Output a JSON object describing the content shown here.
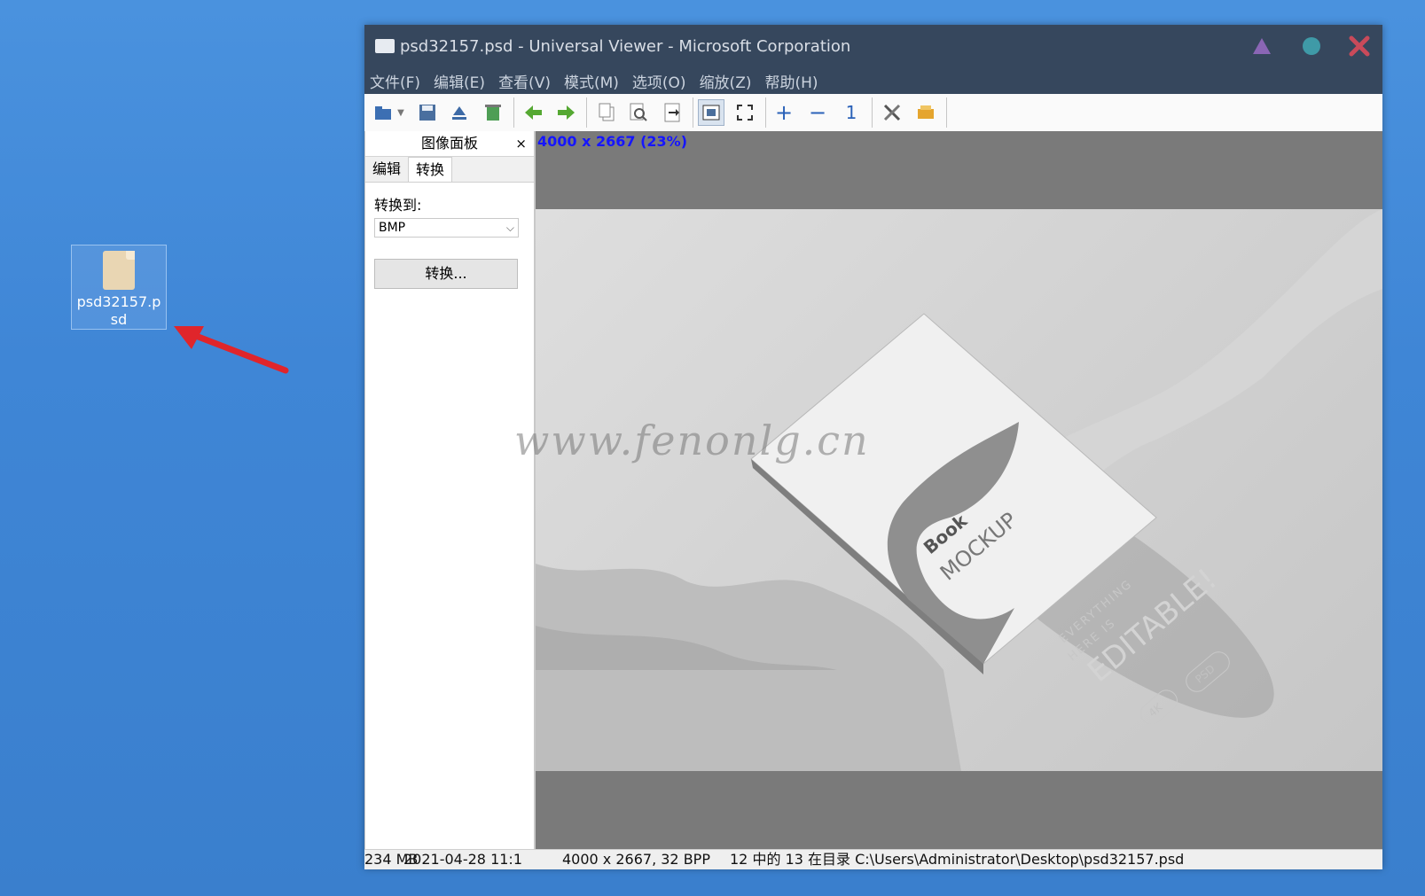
{
  "desktop": {
    "file_label": "psd32157.psd"
  },
  "window": {
    "title": "psd32157.psd - Universal Viewer - Microsoft Corporation",
    "menu": [
      "文件(F)",
      "编辑(E)",
      "查看(V)",
      "模式(M)",
      "选项(O)",
      "缩放(Z)",
      "帮助(H)"
    ],
    "toolbar_icons": [
      "open-icon",
      "dropdown-icon",
      "save-icon",
      "export-icon",
      "recycle-icon",
      "prev-icon",
      "next-icon",
      "copy-icon",
      "preview-icon",
      "print-icon",
      "fit-window-icon",
      "fullscreen-icon",
      "zoom-in-icon",
      "zoom-out-icon",
      "actual-size-icon",
      "settings-icon",
      "plugin-icon"
    ],
    "zoom_in_glyph": "+",
    "zoom_out_glyph": "−",
    "actual_size_glyph": "1",
    "colors": {
      "titlebar": "#36475d",
      "min_btn": "#8a66b5",
      "max_btn": "#3f9aa7",
      "close_btn": "#c94a5a",
      "info_text": "#1616ff"
    }
  },
  "panel": {
    "title": "图像面板",
    "close": "×",
    "tabs": [
      "编辑",
      "转换"
    ],
    "convert_label": "转换到:",
    "format": "BMP",
    "convert_button": "转换..."
  },
  "viewer": {
    "image_info": "4000 x 2667 (23%)",
    "watermark": "www.fenonlg.cn",
    "photo_text": {
      "book": "Book",
      "mockup": "MOCKUP",
      "line1": "EVERYTHING",
      "line2": "HERE IS",
      "editable": "EDITABLE!",
      "badge1": "4K",
      "badge2": "PSD"
    }
  },
  "status": {
    "size": "234 MB",
    "date": "2021-04-28 11:1",
    "dims": "4000 x 2667, 32 BPP",
    "path": "12 中的 13 在目录 C:\\Users\\Administrator\\Desktop\\psd32157.psd"
  }
}
